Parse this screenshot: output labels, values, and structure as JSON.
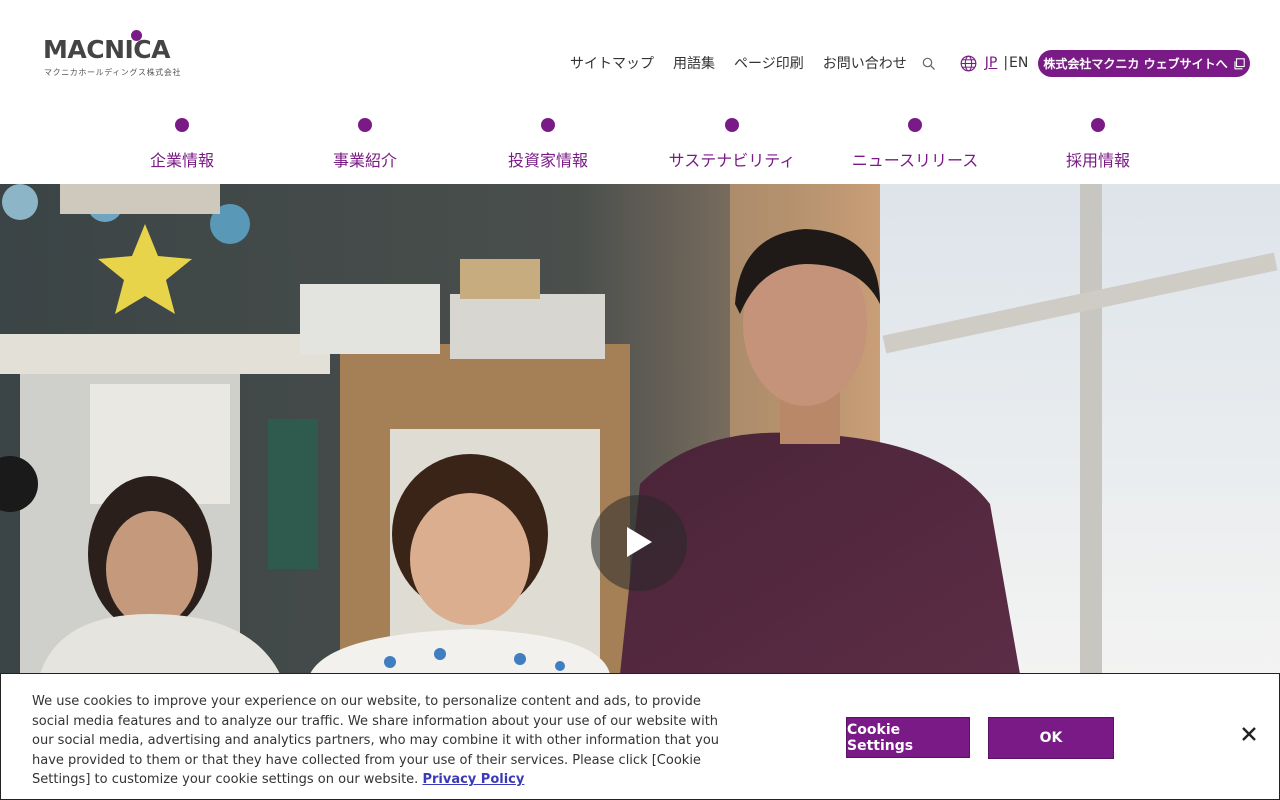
{
  "logo": {
    "wordmark": "MACNICA",
    "subtitle": "マクニカホールディングス株式会社"
  },
  "util_nav": {
    "links": [
      "サイトマップ",
      "用語集",
      "ページ印刷",
      "お問い合わせ"
    ],
    "lang_jp": "JP",
    "lang_sep": "|",
    "lang_en": "EN",
    "corp_button": "株式会社マクニカ ウェブサイトへ"
  },
  "main_nav": {
    "items": [
      "企業情報",
      "事業紹介",
      "投資家情報",
      "サステナビリティ",
      "ニュースリリース",
      "採用情報"
    ]
  },
  "hero": {
    "play_icon": "play-icon"
  },
  "cookie_banner": {
    "text": "We use cookies to improve your experience on our website, to personalize content and ads, to provide social media features and to analyze our traffic. We share information about your use of our website with our social media, advertising and analytics partners, who may combine it with other information that you have provided to them or that they have collected from your use of their services. Please click [Cookie Settings] to customize your cookie settings on our website.",
    "privacy_link": "Privacy Policy",
    "settings_button": "Cookie Settings",
    "ok_button": "OK"
  },
  "colors": {
    "brand": "#7a1a86"
  }
}
